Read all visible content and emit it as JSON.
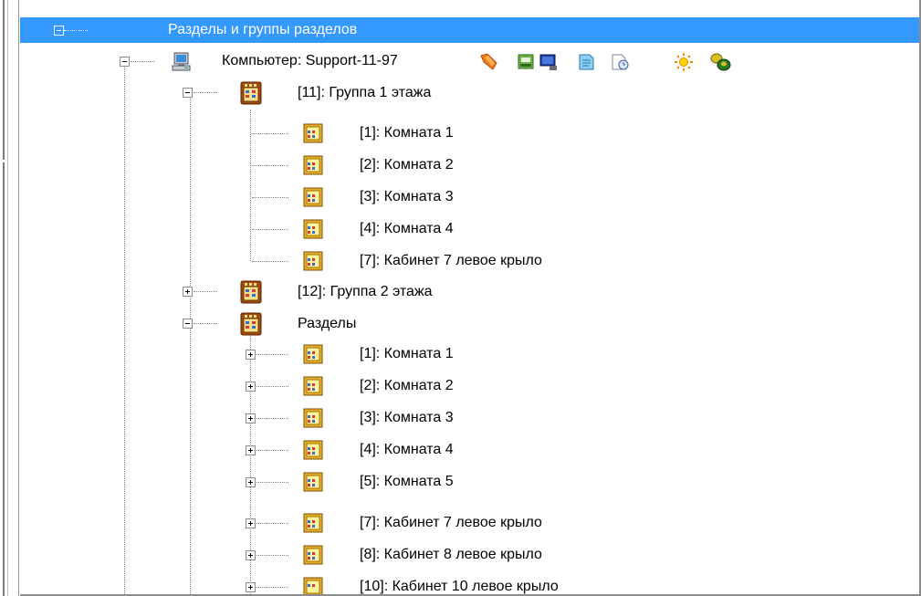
{
  "tree": {
    "header": "Разделы и группы разделов",
    "computer": {
      "label": "Компьютер: Support-11-97",
      "toolbar_icons": [
        "arrow-icon",
        "tape-drive-icon",
        "monitor-icon",
        "document-icon",
        "clock-icon",
        "sun-icon",
        "coins-icon"
      ]
    },
    "group1": {
      "label": "[11]: Группа 1 этажа",
      "items": [
        "[1]: Комната 1",
        "[2]: Комната 2",
        "[3]: Комната 3",
        "[4]: Комната 4",
        "[7]: Кабинет 7 левое крыло"
      ]
    },
    "group2": {
      "label": "[12]: Группа 2 этажа"
    },
    "sections": {
      "label": "Разделы",
      "items": [
        "[1]: Комната 1",
        "[2]: Комната 2",
        "[3]: Комната 3",
        "[4]: Комната 4",
        "[5]: Комната 5",
        "[7]: Кабинет 7 левое крыло",
        "[8]: Кабинет 8 левое крыло",
        "[10]: Кабинет 10 левое крыло"
      ]
    }
  }
}
